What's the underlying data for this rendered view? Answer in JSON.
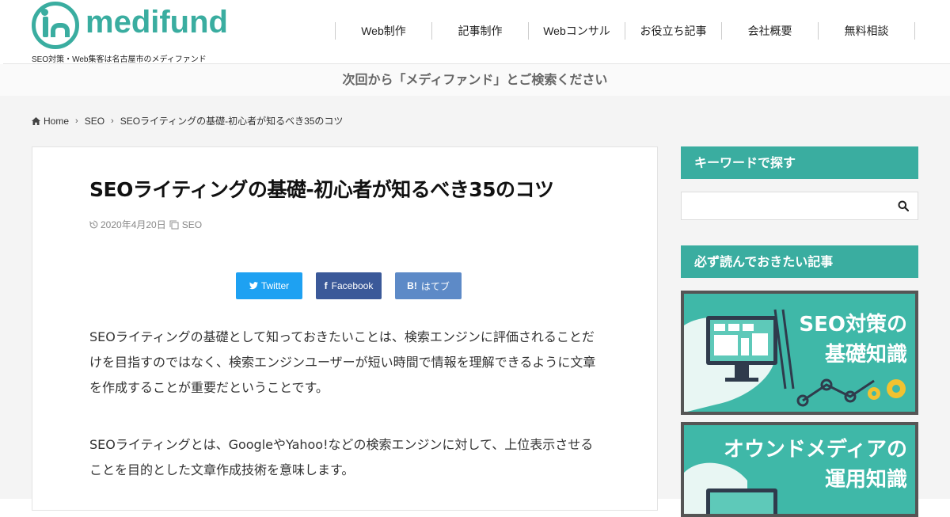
{
  "header": {
    "logo_text": "medifund",
    "tagline": "SEO対策・Web集客は名古屋市のメディファンド",
    "nav": [
      "Web制作",
      "記事制作",
      "Webコンサル",
      "お役立ち記事",
      "会社概要",
      "無料相談"
    ]
  },
  "notice": "次回から「メディファンド」とご検索ください",
  "breadcrumb": {
    "home": "Home",
    "category": "SEO",
    "current": "SEOライティングの基礎-初心者が知るべき35のコツ"
  },
  "article": {
    "title": "SEOライティングの基礎-初心者が知るべき35のコツ",
    "date": "2020年4月20日",
    "category": "SEO",
    "share": {
      "twitter": "Twitter",
      "facebook": "Facebook",
      "hatena_icon": "B!",
      "hatena": "はてブ"
    },
    "paragraphs": [
      "SEOライティングの基礎として知っておきたいことは、検索エンジンに評価されることだけを目指すのではなく、検索エンジンユーザーが短い時間で情報を理解できるように文章を作成することが重要だということです。",
      "SEOライティングとは、GoogleやYahoo!などの検索エンジンに対して、上位表示させることを目的とした文章作成技術を意味します。"
    ]
  },
  "sidebar": {
    "search_heading": "キーワードで探す",
    "must_read_heading": "必ず読んでおきたい記事",
    "banners": [
      {
        "line1": "SEO対策の",
        "line2": "基礎知識"
      },
      {
        "line1": "オウンドメディアの",
        "line2": "運用知識"
      }
    ]
  },
  "colors": {
    "accent": "#3aada0",
    "twitter": "#1ea1f2",
    "facebook": "#3b5999",
    "hatena": "#5d8ac7"
  }
}
